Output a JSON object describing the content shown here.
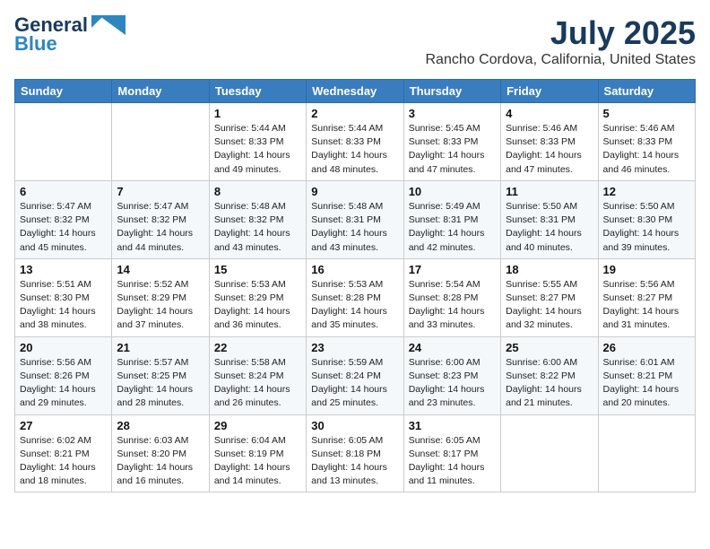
{
  "header": {
    "logo_line1": "General",
    "logo_line2": "Blue",
    "month": "July 2025",
    "location": "Rancho Cordova, California, United States"
  },
  "weekdays": [
    "Sunday",
    "Monday",
    "Tuesday",
    "Wednesday",
    "Thursday",
    "Friday",
    "Saturday"
  ],
  "weeks": [
    [
      {
        "day": "",
        "info": ""
      },
      {
        "day": "",
        "info": ""
      },
      {
        "day": "1",
        "info": "Sunrise: 5:44 AM\nSunset: 8:33 PM\nDaylight: 14 hours and 49 minutes."
      },
      {
        "day": "2",
        "info": "Sunrise: 5:44 AM\nSunset: 8:33 PM\nDaylight: 14 hours and 48 minutes."
      },
      {
        "day": "3",
        "info": "Sunrise: 5:45 AM\nSunset: 8:33 PM\nDaylight: 14 hours and 47 minutes."
      },
      {
        "day": "4",
        "info": "Sunrise: 5:46 AM\nSunset: 8:33 PM\nDaylight: 14 hours and 47 minutes."
      },
      {
        "day": "5",
        "info": "Sunrise: 5:46 AM\nSunset: 8:33 PM\nDaylight: 14 hours and 46 minutes."
      }
    ],
    [
      {
        "day": "6",
        "info": "Sunrise: 5:47 AM\nSunset: 8:32 PM\nDaylight: 14 hours and 45 minutes."
      },
      {
        "day": "7",
        "info": "Sunrise: 5:47 AM\nSunset: 8:32 PM\nDaylight: 14 hours and 44 minutes."
      },
      {
        "day": "8",
        "info": "Sunrise: 5:48 AM\nSunset: 8:32 PM\nDaylight: 14 hours and 43 minutes."
      },
      {
        "day": "9",
        "info": "Sunrise: 5:48 AM\nSunset: 8:31 PM\nDaylight: 14 hours and 43 minutes."
      },
      {
        "day": "10",
        "info": "Sunrise: 5:49 AM\nSunset: 8:31 PM\nDaylight: 14 hours and 42 minutes."
      },
      {
        "day": "11",
        "info": "Sunrise: 5:50 AM\nSunset: 8:31 PM\nDaylight: 14 hours and 40 minutes."
      },
      {
        "day": "12",
        "info": "Sunrise: 5:50 AM\nSunset: 8:30 PM\nDaylight: 14 hours and 39 minutes."
      }
    ],
    [
      {
        "day": "13",
        "info": "Sunrise: 5:51 AM\nSunset: 8:30 PM\nDaylight: 14 hours and 38 minutes."
      },
      {
        "day": "14",
        "info": "Sunrise: 5:52 AM\nSunset: 8:29 PM\nDaylight: 14 hours and 37 minutes."
      },
      {
        "day": "15",
        "info": "Sunrise: 5:53 AM\nSunset: 8:29 PM\nDaylight: 14 hours and 36 minutes."
      },
      {
        "day": "16",
        "info": "Sunrise: 5:53 AM\nSunset: 8:28 PM\nDaylight: 14 hours and 35 minutes."
      },
      {
        "day": "17",
        "info": "Sunrise: 5:54 AM\nSunset: 8:28 PM\nDaylight: 14 hours and 33 minutes."
      },
      {
        "day": "18",
        "info": "Sunrise: 5:55 AM\nSunset: 8:27 PM\nDaylight: 14 hours and 32 minutes."
      },
      {
        "day": "19",
        "info": "Sunrise: 5:56 AM\nSunset: 8:27 PM\nDaylight: 14 hours and 31 minutes."
      }
    ],
    [
      {
        "day": "20",
        "info": "Sunrise: 5:56 AM\nSunset: 8:26 PM\nDaylight: 14 hours and 29 minutes."
      },
      {
        "day": "21",
        "info": "Sunrise: 5:57 AM\nSunset: 8:25 PM\nDaylight: 14 hours and 28 minutes."
      },
      {
        "day": "22",
        "info": "Sunrise: 5:58 AM\nSunset: 8:24 PM\nDaylight: 14 hours and 26 minutes."
      },
      {
        "day": "23",
        "info": "Sunrise: 5:59 AM\nSunset: 8:24 PM\nDaylight: 14 hours and 25 minutes."
      },
      {
        "day": "24",
        "info": "Sunrise: 6:00 AM\nSunset: 8:23 PM\nDaylight: 14 hours and 23 minutes."
      },
      {
        "day": "25",
        "info": "Sunrise: 6:00 AM\nSunset: 8:22 PM\nDaylight: 14 hours and 21 minutes."
      },
      {
        "day": "26",
        "info": "Sunrise: 6:01 AM\nSunset: 8:21 PM\nDaylight: 14 hours and 20 minutes."
      }
    ],
    [
      {
        "day": "27",
        "info": "Sunrise: 6:02 AM\nSunset: 8:21 PM\nDaylight: 14 hours and 18 minutes."
      },
      {
        "day": "28",
        "info": "Sunrise: 6:03 AM\nSunset: 8:20 PM\nDaylight: 14 hours and 16 minutes."
      },
      {
        "day": "29",
        "info": "Sunrise: 6:04 AM\nSunset: 8:19 PM\nDaylight: 14 hours and 14 minutes."
      },
      {
        "day": "30",
        "info": "Sunrise: 6:05 AM\nSunset: 8:18 PM\nDaylight: 14 hours and 13 minutes."
      },
      {
        "day": "31",
        "info": "Sunrise: 6:05 AM\nSunset: 8:17 PM\nDaylight: 14 hours and 11 minutes."
      },
      {
        "day": "",
        "info": ""
      },
      {
        "day": "",
        "info": ""
      }
    ]
  ]
}
